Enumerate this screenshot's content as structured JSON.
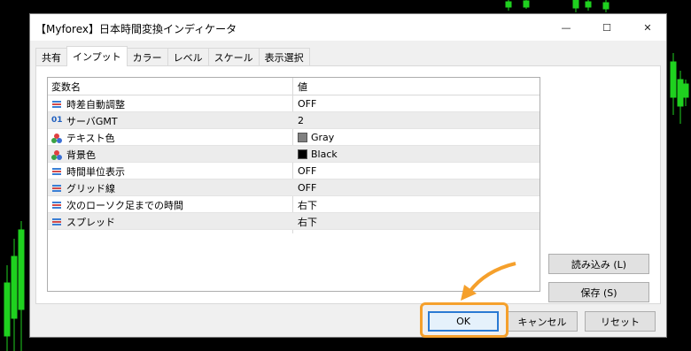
{
  "window": {
    "title": "【Myforex】日本時間変換インディケータ",
    "minimize_glyph": "—",
    "maximize_glyph": "☐",
    "close_glyph": "✕"
  },
  "tabs": [
    {
      "label": "共有"
    },
    {
      "label": "インプット",
      "active": true
    },
    {
      "label": "カラー"
    },
    {
      "label": "レベル"
    },
    {
      "label": "スケール"
    },
    {
      "label": "表示選択"
    }
  ],
  "grid": {
    "headers": {
      "name": "変数名",
      "value": "値"
    },
    "rows": [
      {
        "icon": "property-icon",
        "name": "時差自動調整",
        "value": "OFF"
      },
      {
        "icon": "integer-icon",
        "icon_text": "01",
        "name": "サーバGMT",
        "value": "2"
      },
      {
        "icon": "color-icon",
        "name": "テキスト色",
        "value": "Gray",
        "swatch": "#808080"
      },
      {
        "icon": "color-icon",
        "name": "背景色",
        "value": "Black",
        "swatch": "#000000"
      },
      {
        "icon": "property-icon",
        "name": "時間単位表示",
        "value": "OFF"
      },
      {
        "icon": "property-icon",
        "name": "グリッド線",
        "value": "OFF"
      },
      {
        "icon": "property-icon",
        "name": "次のローソク足までの時間",
        "value": "右下"
      },
      {
        "icon": "property-icon",
        "name": "スプレッド",
        "value": "右下"
      }
    ]
  },
  "side_buttons": {
    "load": "読み込み (L)",
    "save": "保存 (S)"
  },
  "footer_buttons": {
    "ok": "OK",
    "cancel": "キャンセル",
    "reset": "リセット"
  },
  "colors": {
    "accent": "#2a7ad3",
    "highlight": "#f5a02c",
    "chart_up": "#1fd11f"
  }
}
